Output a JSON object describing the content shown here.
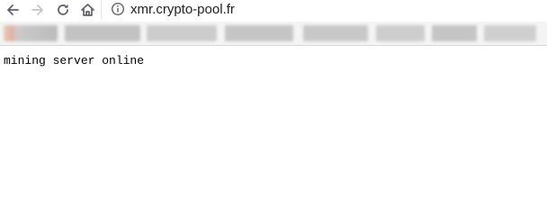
{
  "browser": {
    "toolbar": {
      "back_icon": "arrow-left-icon",
      "forward_icon": "arrow-right-icon",
      "reload_icon": "reload-icon",
      "home_icon": "home-icon"
    },
    "address_bar": {
      "security_icon": "info-circle-icon",
      "url": "xmr.crypto-pool.fr"
    },
    "bookmarks_bar": {
      "state": "blurred",
      "items": [
        "",
        "",
        "",
        "",
        "",
        "",
        ""
      ]
    }
  },
  "page": {
    "body_text": "mining server online"
  }
}
